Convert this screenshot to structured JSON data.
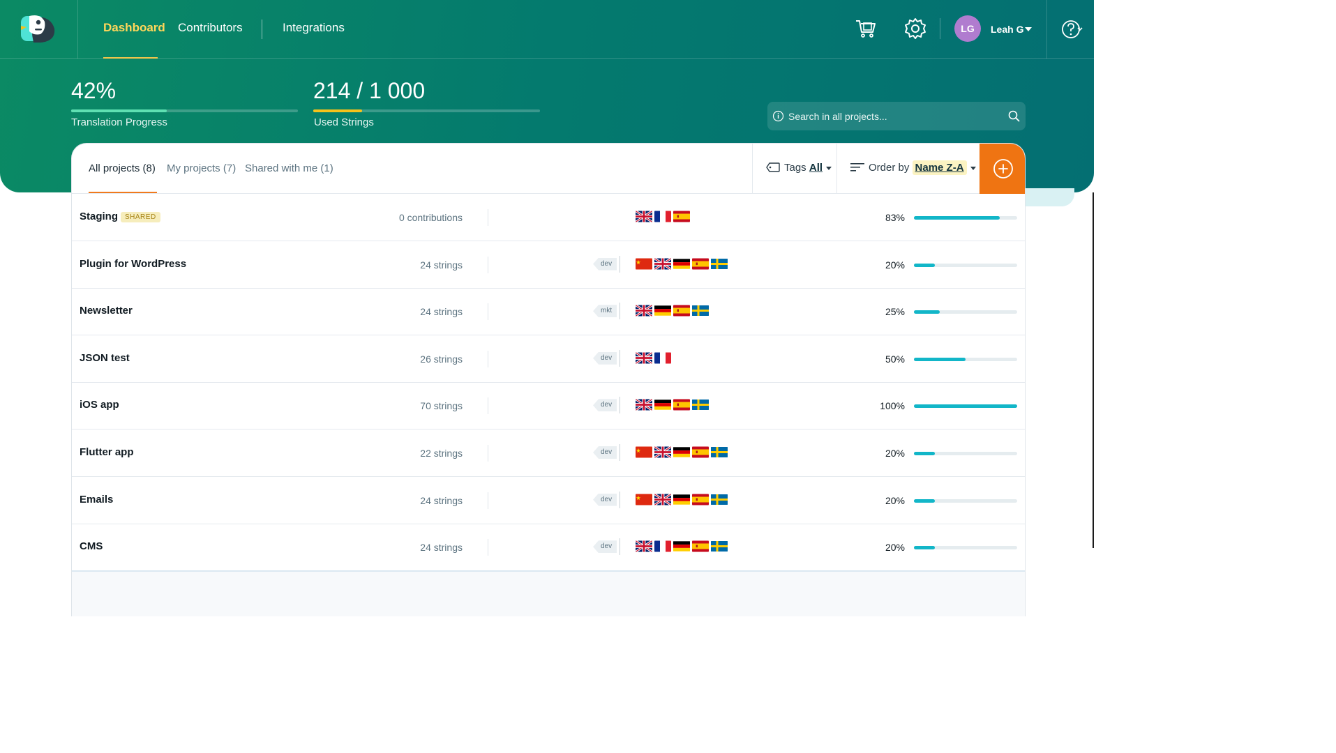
{
  "nav": {
    "items": [
      {
        "label": "Dashboard",
        "active": true
      },
      {
        "label": "Contributors"
      },
      {
        "label": "Integrations"
      }
    ]
  },
  "user": {
    "initials": "LG",
    "name": "Leah G"
  },
  "stats": {
    "progress": {
      "value": "42%",
      "label": "Translation Progress",
      "fill_fraction": 0.42
    },
    "strings": {
      "value": "214 / 1 000",
      "label": "Used Strings",
      "fill_fraction": 0.214
    }
  },
  "search": {
    "placeholder": "Search in all projects..."
  },
  "tabs": [
    "All projects (8)",
    "My projects (7)",
    "Shared with me (1)"
  ],
  "filters": {
    "tags_label": "Tags",
    "tags_value": "All",
    "order_label": "Order by",
    "order_value": "Name Z-A"
  },
  "projects": [
    {
      "name": "Staging",
      "badge": "SHARED",
      "count": "0 contributions",
      "tag": "",
      "flags": [
        "gb",
        "fr",
        "es"
      ],
      "percent": "83%",
      "fill": 0.83
    },
    {
      "name": "Plugin for WordPress",
      "badge": "",
      "count": "24 strings",
      "tag": "dev",
      "flags": [
        "cn",
        "gb",
        "de",
        "es",
        "se"
      ],
      "percent": "20%",
      "fill": 0.2
    },
    {
      "name": "Newsletter",
      "badge": "",
      "count": "24 strings",
      "tag": "mkt",
      "flags": [
        "gb",
        "de",
        "es",
        "se"
      ],
      "percent": "25%",
      "fill": 0.25
    },
    {
      "name": "JSON test",
      "badge": "",
      "count": "26 strings",
      "tag": "dev",
      "flags": [
        "gb",
        "fr"
      ],
      "percent": "50%",
      "fill": 0.5
    },
    {
      "name": "iOS app",
      "badge": "",
      "count": "70 strings",
      "tag": "dev",
      "flags": [
        "gb",
        "de",
        "es",
        "se"
      ],
      "percent": "100%",
      "fill": 1.0
    },
    {
      "name": "Flutter app",
      "badge": "",
      "count": "22 strings",
      "tag": "dev",
      "flags": [
        "cn",
        "gb",
        "de",
        "es",
        "se"
      ],
      "percent": "20%",
      "fill": 0.2
    },
    {
      "name": "Emails",
      "badge": "",
      "count": "24 strings",
      "tag": "dev",
      "flags": [
        "cn",
        "gb",
        "de",
        "es",
        "se"
      ],
      "percent": "20%",
      "fill": 0.2
    },
    {
      "name": "CMS",
      "badge": "",
      "count": "24 strings",
      "tag": "dev",
      "flags": [
        "gb",
        "fr",
        "de",
        "es",
        "se"
      ],
      "percent": "20%",
      "fill": 0.2
    }
  ],
  "icons": {
    "cart": "cart-icon",
    "settings": "gear-icon",
    "help": "help-icon",
    "search": "search-icon",
    "info": "info-icon",
    "tag": "tag-icon",
    "sort": "sort-icon",
    "add": "plus-circle-icon"
  },
  "colors": {
    "accent_orange": "#ef7412",
    "progress_teal": "#12b6c8",
    "hero_green": "#0b8a64",
    "nav_active": "#ffd75a",
    "strings_bar": "#f5c21b",
    "progress_bar": "#5fe0b2"
  }
}
